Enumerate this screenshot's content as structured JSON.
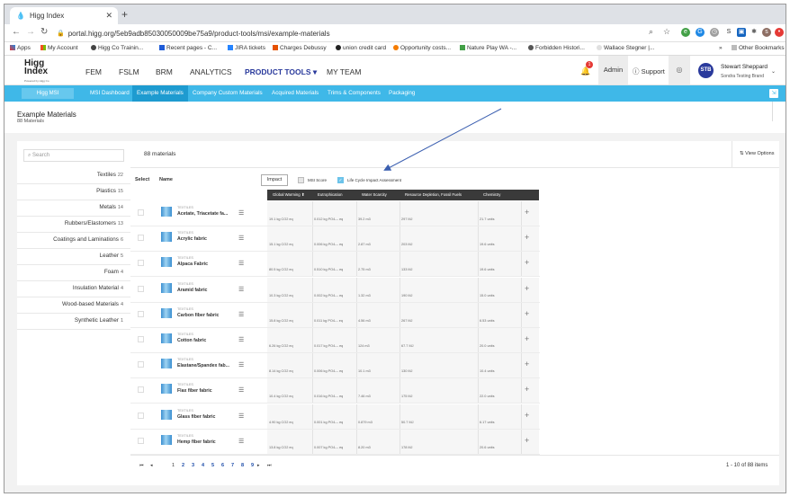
{
  "browser": {
    "tab_title": "Higg Index",
    "url": "portal.higg.org/5eb9adb85030050009be75a9/product-tools/msi/example-materials",
    "bookmarks": [
      "Apps",
      "My Account",
      "Higg Co Trainin...",
      "Recent pages - C...",
      "JIRA tickets",
      "Charges Debussy",
      "union credit card",
      "Opportunity costs...",
      "Nature Play WA -...",
      "Forbidden Histori...",
      "Wallace Stegner |...",
      "Other Bookmarks"
    ]
  },
  "header": {
    "logo_line1": "Higg",
    "logo_line2": "Index",
    "logo_sub": "Powered by Higg Co",
    "nav": [
      "FEM",
      "FSLM",
      "BRM",
      "ANALYTICS",
      "PRODUCT TOOLS",
      "MY TEAM"
    ],
    "nav_active_label": "PRODUCT TOOLS ▾",
    "notification_count": "1",
    "admin": "Admin",
    "support": "Support",
    "avatar_initials": "STB",
    "user_name": "Stewart Sheppard",
    "user_brand": "Sondra Testing Brand"
  },
  "subnav": {
    "msi_button": "Higg MSI",
    "items": [
      "MSI Dashboard",
      "Example Materials",
      "Company Custom Materials",
      "Acquired Materials",
      "Trims & Components",
      "Packaging"
    ]
  },
  "page": {
    "title": "Example Materials",
    "subtitle": "88 Materials"
  },
  "filters": {
    "search_placeholder": "Search",
    "categories": [
      {
        "label": "Textiles",
        "count": "22"
      },
      {
        "label": "Plastics",
        "count": "15"
      },
      {
        "label": "Metals",
        "count": "14"
      },
      {
        "label": "Rubbers/Elastomers",
        "count": "13"
      },
      {
        "label": "Coatings and Laminations",
        "count": "6"
      },
      {
        "label": "Leather",
        "count": "5"
      },
      {
        "label": "Foam",
        "count": "4"
      },
      {
        "label": "Insulation Material",
        "count": "4"
      },
      {
        "label": "Wood-based Materials",
        "count": "4"
      },
      {
        "label": "Synthetic Leather",
        "count": "1"
      }
    ]
  },
  "results": {
    "count_label": "88 materials",
    "view_options": "View Options",
    "select_header": "Select",
    "name_header": "Name",
    "impact_button": "Impact",
    "msi_score_label": "MSI Score",
    "lca_label": "Life Cycle Impact Assessment",
    "columns": [
      "Global Warming ⬆",
      "Eutrophication",
      "Water Scarcity",
      "Resource Depletion, Fossil Fuels",
      "Chemistry"
    ],
    "rows": [
      {
        "category": "TEXTILES",
        "name": "Acetate, Triacetate fa...",
        "gw": "19.1 kg CO2 eq",
        "eu": "0.012 kg PO4--- eq",
        "ws": "39.2 m3",
        "rd": "297 MJ",
        "ch": "21.7 units"
      },
      {
        "category": "TEXTILES",
        "name": "Acrylic fabric",
        "gw": "15.1 kg CO2 eq",
        "eu": "0.006 kg PO4--- eq",
        "ws": "2.87 m3",
        "rd": "203 MJ",
        "ch": "19.6 units"
      },
      {
        "category": "TEXTILES",
        "name": "Alpaca Fabric",
        "gw": "80.5 kg CO2 eq",
        "eu": "0.510 kg PO4--- eq",
        "ws": "2.75 m3",
        "rd": "133 MJ",
        "ch": "19.6 units"
      },
      {
        "category": "TEXTILES",
        "name": "Aramid fabric",
        "gw": "10.3 kg CO2 eq",
        "eu": "0.002 kg PO4--- eq",
        "ws": "1.32 m3",
        "rd": "190 MJ",
        "ch": "15.0 units"
      },
      {
        "category": "TEXTILES",
        "name": "Carbon fiber fabric",
        "gw": "15.8 kg CO2 eq",
        "eu": "0.011 kg PO4--- eq",
        "ws": "4.56 m3",
        "rd": "267 MJ",
        "ch": "6.53 units"
      },
      {
        "category": "TEXTILES",
        "name": "Cotton fabric",
        "gw": "6.26 kg CO2 eq",
        "eu": "0.017 kg PO4--- eq",
        "ws": "124 m3",
        "rd": "67.7 MJ",
        "ch": "20.0 units"
      },
      {
        "category": "TEXTILES",
        "name": "Elastane/Spandex fab...",
        "gw": "8.14 kg CO2 eq",
        "eu": "0.006 kg PO4--- eq",
        "ws": "10.1 m3",
        "rd": "130 MJ",
        "ch": "10.4 units"
      },
      {
        "category": "TEXTILES",
        "name": "Flax fiber fabric",
        "gw": "10.4 kg CO2 eq",
        "eu": "0.016 kg PO4--- eq",
        "ws": "7.46 m3",
        "rd": "175 MJ",
        "ch": "22.0 units"
      },
      {
        "category": "TEXTILES",
        "name": "Glass fiber fabric",
        "gw": "4.90 kg CO2 eq",
        "eu": "0.001 kg PO4--- eq",
        "ws": "0.879 m3",
        "rd": "50.7 MJ",
        "ch": "6.17 units"
      },
      {
        "category": "TEXTILES",
        "name": "Hemp fiber fabric",
        "gw": "13.8 kg CO2 eq",
        "eu": "0.007 kg PO4--- eq",
        "ws": "8.20 m3",
        "rd": "178 MJ",
        "ch": "20.6 units"
      }
    ]
  },
  "pagination": {
    "first": "⏮",
    "prev": "◂",
    "pages": [
      "1",
      "2",
      "3",
      "4",
      "5",
      "6",
      "7",
      "8",
      "9"
    ],
    "next": "▸",
    "last": "⏭",
    "summary": "1 - 10 of 88 items"
  },
  "colors": {
    "accent": "#3fb8e8",
    "nav_active": "#2a3a9c",
    "header_dark": "#3a3a3a"
  }
}
